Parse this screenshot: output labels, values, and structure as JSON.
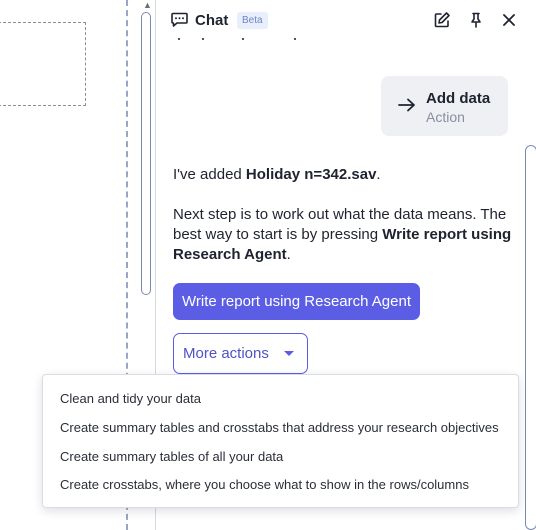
{
  "chat": {
    "title": "Chat",
    "badge": "Beta",
    "header_icons": [
      "edit-icon",
      "pin-icon",
      "close-icon"
    ]
  },
  "action_card": {
    "title": "Add data",
    "subtitle": "Action",
    "icon": "arrow-right-icon"
  },
  "messages": {
    "added_prefix": "I've added ",
    "added_file": "Holiday n=342.sav",
    "added_suffix": ".",
    "next_text": "Next step is to work out what the data means. The best way to start is by pressing ",
    "next_bold": "Write report using Research Agent",
    "next_suffix": "."
  },
  "buttons": {
    "primary": "Write report using Research Agent",
    "more": "More actions"
  },
  "menu": {
    "items": [
      "Clean and tidy your data",
      "Create summary tables and crosstabs that address your research objectives",
      "Create summary tables of all your data",
      "Create crosstabs, where you choose what to show in the rows/columns"
    ]
  },
  "colors": {
    "accent": "#5b5ee5",
    "card_bg": "#eef0f4",
    "badge_bg": "#e8eefb",
    "badge_text": "#6e86c8"
  }
}
